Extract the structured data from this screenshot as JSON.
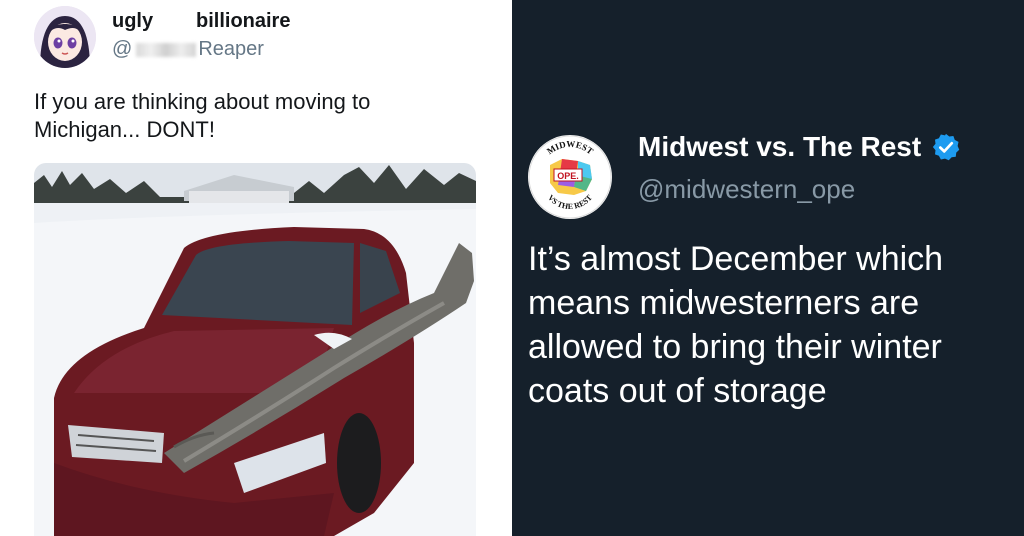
{
  "left_tweet": {
    "display_name_part1": "ugly",
    "display_name_part2": "billionaire",
    "handle_prefix": "@",
    "handle_suffix": "Reaper",
    "text": "If you are thinking about moving to\nMichigan... DONT!",
    "avatar": "anime-girl-avatar",
    "photo": "red-car-with-large-fish-on-hood-in-snow"
  },
  "right_tweet": {
    "display_name": "Midwest vs. The Rest",
    "handle": "@midwestern_ope",
    "text": "It’s almost December which\nmeans midwesterners are\nallowed to bring their winter\ncoats out of storage",
    "avatar_label_center": "OPE.",
    "avatar_ring_top": "MIDWEST",
    "avatar_ring_bottom": "VS THE REST",
    "verified_icon": "verified-badge-icon"
  },
  "colors": {
    "left_bg": "#ffffff",
    "right_bg": "#15202b",
    "left_text": "#14171a",
    "left_handle": "#657786",
    "right_handle": "#8899a6",
    "verified_blue": "#1d9bf0"
  }
}
